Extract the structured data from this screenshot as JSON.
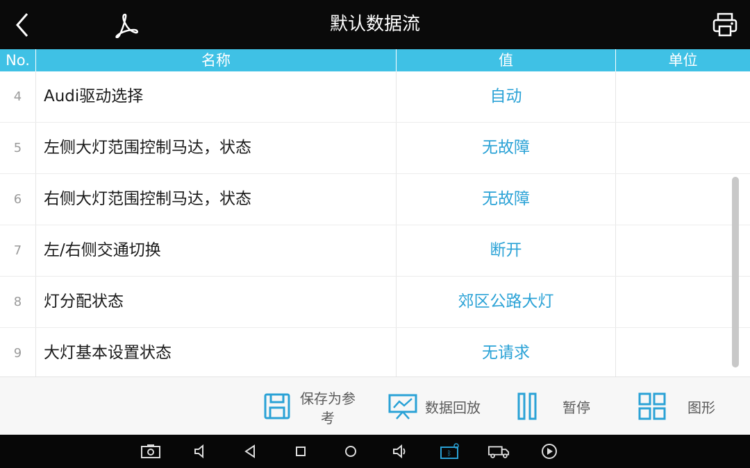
{
  "header": {
    "title": "默认数据流",
    "back_icon": "chevron-left-icon",
    "pdf_icon": "pdf-icon",
    "print_icon": "print-icon"
  },
  "table": {
    "columns": [
      "No.",
      "名称",
      "值",
      "单位"
    ],
    "rows": [
      {
        "no": "4",
        "name": "Audi驱动选择",
        "value": "自动",
        "unit": ""
      },
      {
        "no": "5",
        "name": "左侧大灯范围控制马达，状态",
        "value": "无故障",
        "unit": ""
      },
      {
        "no": "6",
        "name": "右侧大灯范围控制马达，状态",
        "value": "无故障",
        "unit": ""
      },
      {
        "no": "7",
        "name": "左/右侧交通切换",
        "value": "断开",
        "unit": ""
      },
      {
        "no": "8",
        "name": "灯分配状态",
        "value": "郊区公路大灯",
        "unit": ""
      },
      {
        "no": "9",
        "name": "大灯基本设置状态",
        "value": "无请求",
        "unit": ""
      }
    ]
  },
  "toolbar": {
    "save_line1": "保存为参",
    "save_line2": "考",
    "playback_label": "数据回放",
    "pause_label": "暂停",
    "graph_label": "图形"
  },
  "colors": {
    "header_bg": "#0a0a0a",
    "table_header_bg": "#3fc1e5",
    "value_text": "#2aa2d6",
    "icon_blue": "#2aa2d6"
  },
  "navbar": {
    "icons": [
      "screenshot-icon",
      "volume-down-icon",
      "back-icon",
      "recents-icon",
      "home-icon",
      "volume-up-icon",
      "vci-connect-icon",
      "truck-icon",
      "media-play-icon"
    ]
  }
}
